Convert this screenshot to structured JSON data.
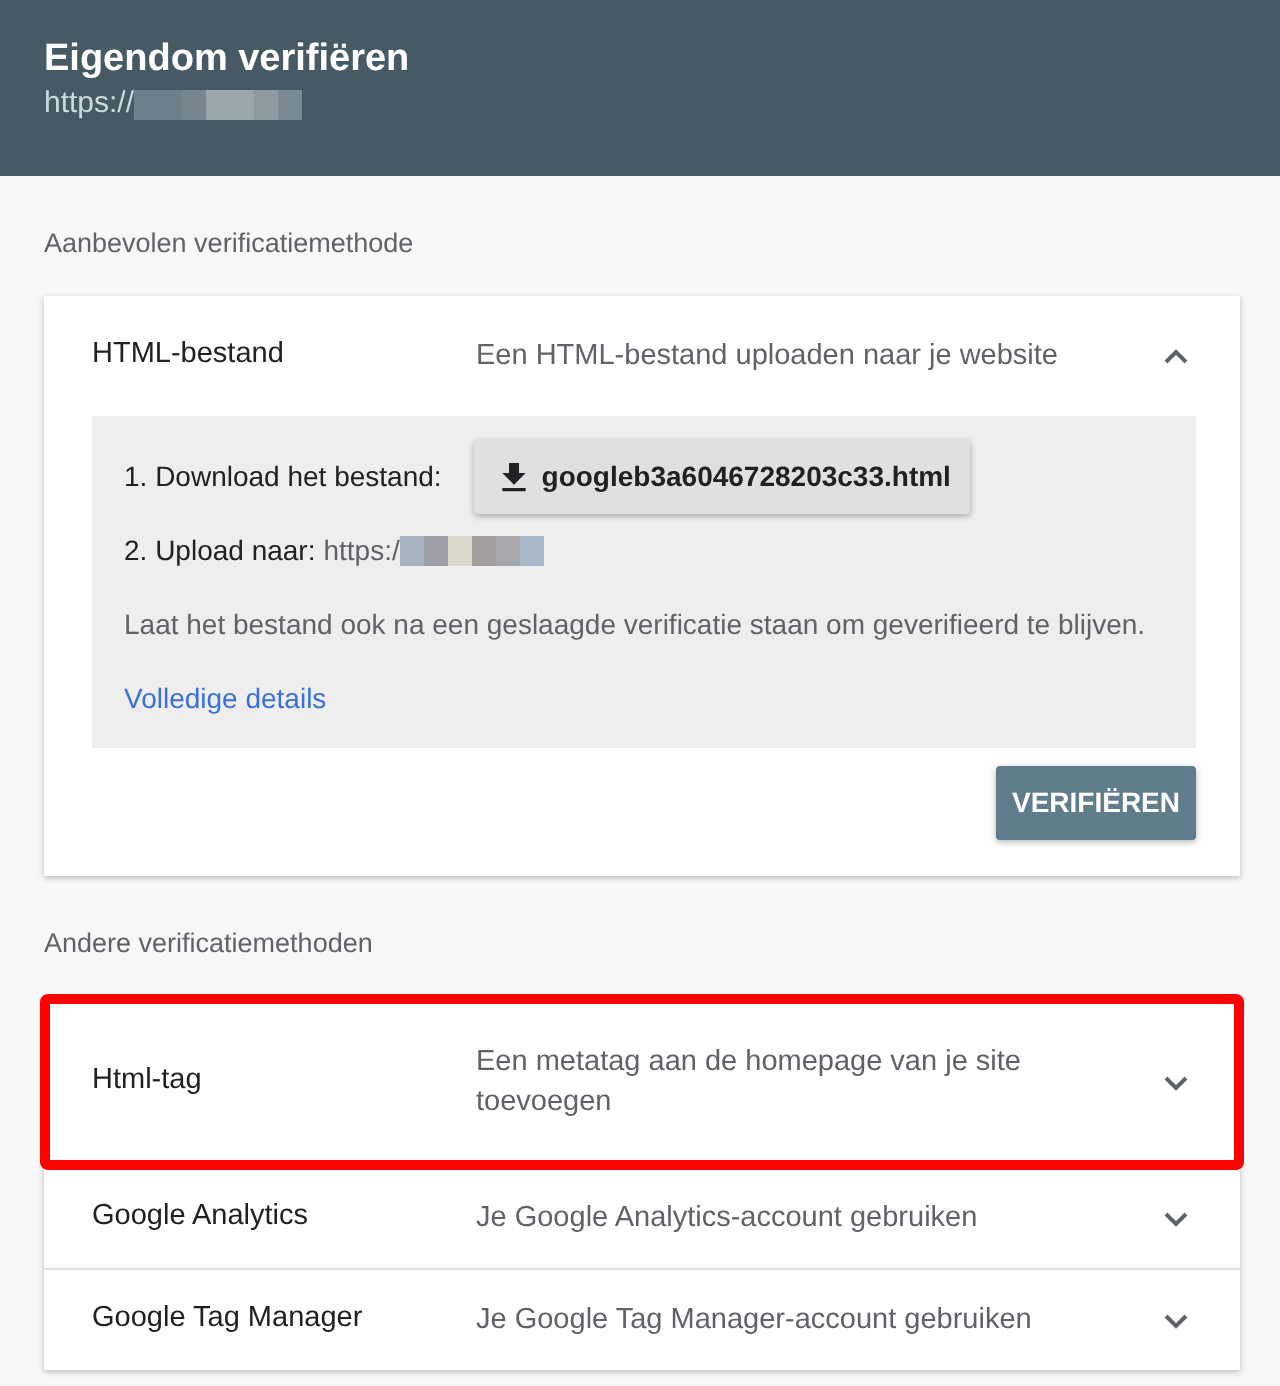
{
  "header": {
    "title": "Eigendom verifiëren",
    "url_prefix": "https://"
  },
  "recommended": {
    "label": "Aanbevolen verificatiemethode",
    "method": {
      "name": "HTML-bestand",
      "description": "Een HTML-bestand uploaden naar je website",
      "expanded": true,
      "step_1": "1. Download het bestand:",
      "file_button": "googleb3a6046728203c33.html",
      "step_2": "2. Upload naar:",
      "upload_url_prefix": "https:/",
      "note": "Laat het bestand ook na een geslaagde verificatie staan om geverifieerd te blijven.",
      "link": "Volledige details",
      "verify_button": "VERIFIËREN"
    }
  },
  "other": {
    "label": "Andere verificatiemethoden",
    "methods": [
      {
        "name": "Html-tag",
        "description": "Een metatag aan de homepage van je site toevoegen",
        "expanded": false,
        "highlighted": true
      },
      {
        "name": "Google Analytics",
        "description": "Je Google Analytics-account gebruiken",
        "expanded": false,
        "highlighted": false
      },
      {
        "name": "Google Tag Manager",
        "description": "Je Google Tag Manager-account gebruiken",
        "expanded": false,
        "highlighted": false
      }
    ]
  }
}
